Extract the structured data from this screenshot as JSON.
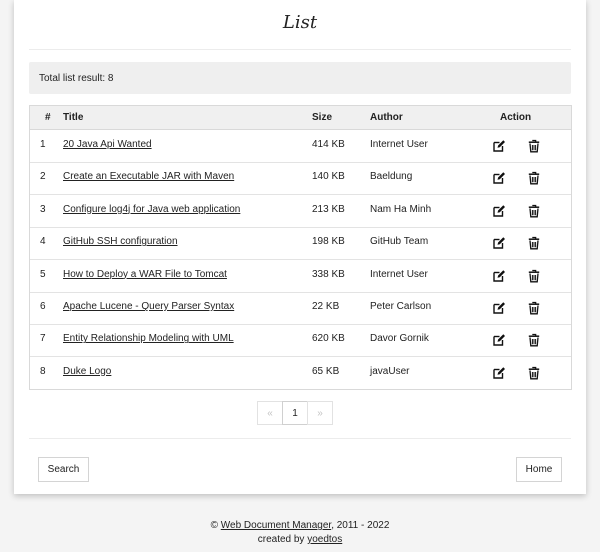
{
  "page": {
    "title": "List"
  },
  "summary": {
    "text": "Total list result: 8"
  },
  "table": {
    "headers": {
      "num": "#",
      "title": "Title",
      "size": "Size",
      "author": "Author",
      "action": "Action"
    },
    "rows": [
      {
        "num": "1",
        "title": "20 Java Api Wanted",
        "size": "414 KB",
        "author": "Internet User"
      },
      {
        "num": "2",
        "title": "Create an Executable JAR with Maven",
        "size": "140 KB",
        "author": "Baeldung"
      },
      {
        "num": "3",
        "title": "Configure log4j for Java web application",
        "size": "213 KB",
        "author": "Nam Ha Minh"
      },
      {
        "num": "4",
        "title": "GitHub SSH configuration",
        "size": "198 KB",
        "author": "GitHub Team"
      },
      {
        "num": "5",
        "title": "How to Deploy a WAR File to Tomcat",
        "size": "338 KB",
        "author": "Internet User"
      },
      {
        "num": "6",
        "title": "Apache Lucene - Query Parser Syntax",
        "size": "22 KB",
        "author": "Peter Carlson"
      },
      {
        "num": "7",
        "title": "Entity Relationship Modeling with UML",
        "size": "620 KB",
        "author": "Davor Gornik"
      },
      {
        "num": "8",
        "title": "Duke Logo",
        "size": "65 KB",
        "author": "javaUser"
      }
    ],
    "row_icons": {
      "edit": "edit-icon",
      "delete": "trash-icon"
    }
  },
  "pagination": {
    "prev": "«",
    "current": "1",
    "next": "»"
  },
  "buttons": {
    "search": "Search",
    "home": "Home"
  },
  "footer": {
    "copyright": "©",
    "app_link": "Web Document Manager",
    "years": ", 2011 - 2022",
    "created_by": "created by",
    "author_link": "yoedtos"
  }
}
